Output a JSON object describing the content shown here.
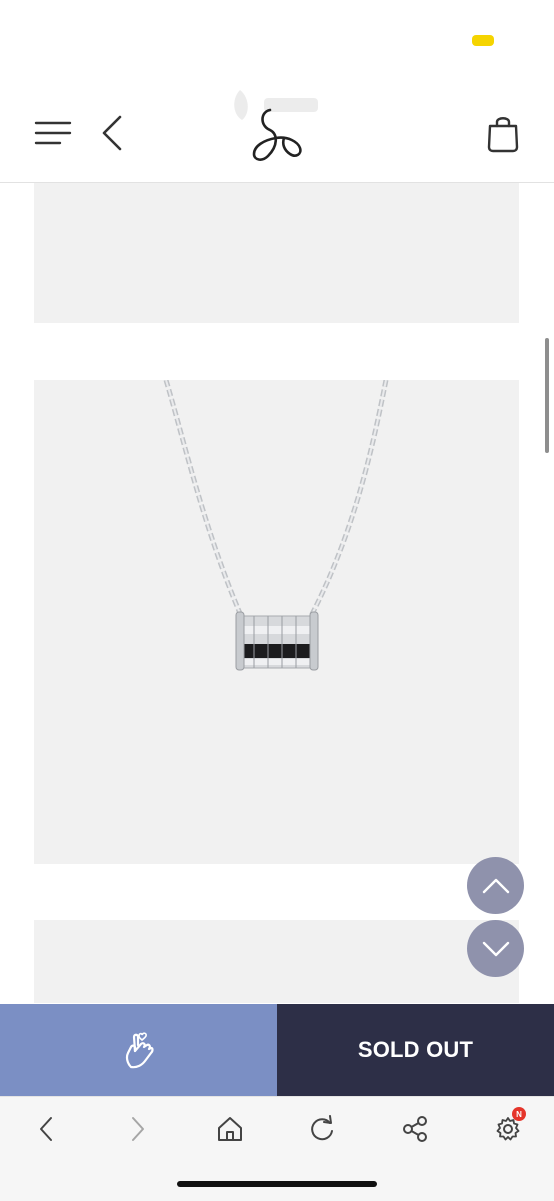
{
  "colors": {
    "status_pill": "#f5d400",
    "panel_bg": "#f1f1f1",
    "like_button_bg": "#7b8fc4",
    "soldout_button_bg": "#2d2f47",
    "float_button_bg": "#8f92ac",
    "badge_red": "#e5352b",
    "icon_dark": "#333333"
  },
  "header": {
    "menu_icon": "hamburger-menu-icon",
    "back_icon": "chevron-left-icon",
    "logo": "ampersand-logo",
    "bag_icon": "shopping-bag-icon"
  },
  "product": {
    "image": "silver-chain-necklace-with-cylinder-combination-pendant"
  },
  "floating": {
    "up_icon": "chevron-up-icon",
    "down_icon": "chevron-down-icon"
  },
  "action_bar": {
    "like_icon": "finger-heart-hand-icon",
    "soldout_label": "SOLD OUT"
  },
  "browser_bar": {
    "back_icon": "chevron-left-icon",
    "forward_icon": "chevron-right-icon",
    "home_icon": "home-icon",
    "refresh_icon": "refresh-icon",
    "share_icon": "share-icon",
    "settings_icon": "gear-icon",
    "settings_badge": "N"
  }
}
